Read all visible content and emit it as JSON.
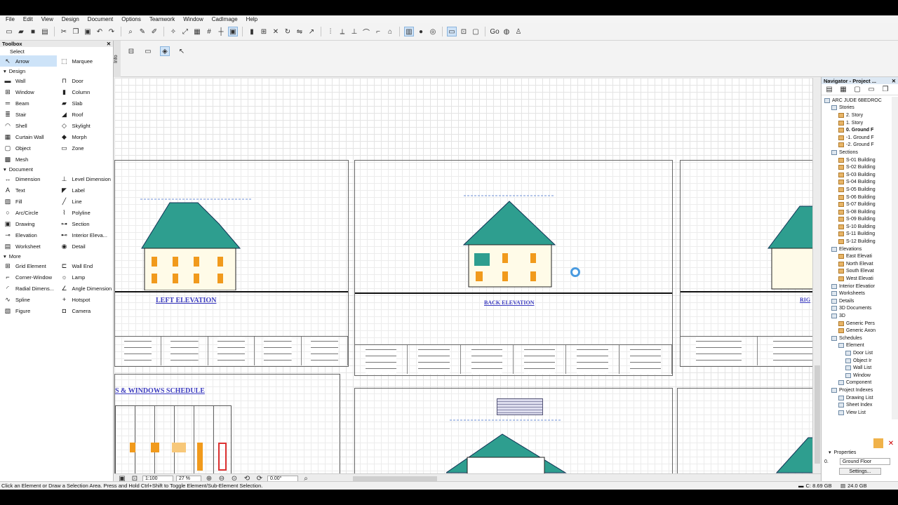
{
  "menu": [
    "File",
    "Edit",
    "View",
    "Design",
    "Document",
    "Options",
    "Teamwork",
    "Window",
    "CadImage",
    "Help"
  ],
  "toolbox": {
    "title": "Toolbox",
    "select_label": "Select",
    "select_items": [
      "Arrow",
      "Marquee"
    ],
    "sections": [
      {
        "name": "Design",
        "items": [
          [
            "Wall",
            "Door"
          ],
          [
            "Window",
            "Column"
          ],
          [
            "Beam",
            "Slab"
          ],
          [
            "Stair",
            "Roof"
          ],
          [
            "Shell",
            "Skylight"
          ],
          [
            "Curtain Wall",
            "Morph"
          ],
          [
            "Object",
            "Zone"
          ],
          [
            "Mesh",
            ""
          ]
        ]
      },
      {
        "name": "Document",
        "items": [
          [
            "Dimension",
            "Level Dimension"
          ],
          [
            "Text",
            "Label"
          ],
          [
            "Fill",
            "Line"
          ],
          [
            "Arc/Circle",
            "Polyline"
          ],
          [
            "Drawing",
            "Section"
          ],
          [
            "Elevation",
            "Interior Eleva..."
          ],
          [
            "Worksheet",
            "Detail"
          ]
        ]
      },
      {
        "name": "More",
        "items": [
          [
            "Grid Element",
            "Wall End"
          ],
          [
            "Corner-Window",
            "Lamp"
          ],
          [
            "Radial Dimens...",
            "Angle Dimension"
          ],
          [
            "Spline",
            "Hotspot"
          ],
          [
            "Figure",
            "Camera"
          ]
        ]
      }
    ]
  },
  "info_label": "Info",
  "canvas": {
    "left_elevation": "LEFT ELEVATION",
    "back_elevation": "BACK ELEVATION",
    "right_partial": "RIG",
    "schedule": "S & WINDOWS SCHEDULE"
  },
  "bottom": {
    "scale": "1:100",
    "zoom": "27 %",
    "angle": "0.00°"
  },
  "navigator": {
    "title": "Navigator - Project ...",
    "tree": [
      {
        "d": 0,
        "t": "ARC JUDE 6BEDROC",
        "k": "fo"
      },
      {
        "d": 1,
        "t": "Stories",
        "k": "fo"
      },
      {
        "d": 2,
        "t": "2. Story",
        "k": "fi"
      },
      {
        "d": 2,
        "t": "1. Story",
        "k": "fi"
      },
      {
        "d": 2,
        "t": "0. Ground F",
        "k": "fi",
        "b": true
      },
      {
        "d": 2,
        "t": "-1. Ground F",
        "k": "fi"
      },
      {
        "d": 2,
        "t": "-2. Ground F",
        "k": "fi"
      },
      {
        "d": 1,
        "t": "Sections",
        "k": "fo"
      },
      {
        "d": 2,
        "t": "S-01 Building",
        "k": "fi"
      },
      {
        "d": 2,
        "t": "S-02 Building",
        "k": "fi"
      },
      {
        "d": 2,
        "t": "S-03 Building",
        "k": "fi"
      },
      {
        "d": 2,
        "t": "S-04 Building",
        "k": "fi"
      },
      {
        "d": 2,
        "t": "S-05 Building",
        "k": "fi"
      },
      {
        "d": 2,
        "t": "S-06 Building",
        "k": "fi"
      },
      {
        "d": 2,
        "t": "S-07 Building",
        "k": "fi"
      },
      {
        "d": 2,
        "t": "S-08 Building",
        "k": "fi"
      },
      {
        "d": 2,
        "t": "S-09 Building",
        "k": "fi"
      },
      {
        "d": 2,
        "t": "S-10 Building",
        "k": "fi"
      },
      {
        "d": 2,
        "t": "S-11 Building",
        "k": "fi"
      },
      {
        "d": 2,
        "t": "S-12 Building",
        "k": "fi"
      },
      {
        "d": 1,
        "t": "Elevations",
        "k": "fo"
      },
      {
        "d": 2,
        "t": "East Elevati",
        "k": "fi"
      },
      {
        "d": 2,
        "t": "North Elevat",
        "k": "fi"
      },
      {
        "d": 2,
        "t": "South Elevat",
        "k": "fi"
      },
      {
        "d": 2,
        "t": "West Elevati",
        "k": "fi"
      },
      {
        "d": 1,
        "t": "Interior Elevatior",
        "k": "fo"
      },
      {
        "d": 1,
        "t": "Worksheets",
        "k": "fo"
      },
      {
        "d": 1,
        "t": "Details",
        "k": "fo"
      },
      {
        "d": 1,
        "t": "3D Documents",
        "k": "fo"
      },
      {
        "d": 1,
        "t": "3D",
        "k": "fo"
      },
      {
        "d": 2,
        "t": "Generic Pers",
        "k": "fi"
      },
      {
        "d": 2,
        "t": "Generic Axon",
        "k": "fi"
      },
      {
        "d": 1,
        "t": "Schedules",
        "k": "fo"
      },
      {
        "d": 2,
        "t": "Element",
        "k": "fo"
      },
      {
        "d": 3,
        "t": "Door List",
        "k": "fo"
      },
      {
        "d": 3,
        "t": "Object Ir",
        "k": "fo"
      },
      {
        "d": 3,
        "t": "Wall List",
        "k": "fo"
      },
      {
        "d": 3,
        "t": "Window",
        "k": "fo"
      },
      {
        "d": 2,
        "t": "Component",
        "k": "fo"
      },
      {
        "d": 1,
        "t": "Project Indexes",
        "k": "fo"
      },
      {
        "d": 2,
        "t": "Drawing List",
        "k": "fo"
      },
      {
        "d": 2,
        "t": "Sheet Index",
        "k": "fo"
      },
      {
        "d": 2,
        "t": "View List",
        "k": "fo"
      }
    ],
    "properties_label": "Properties",
    "prop_num": "0.",
    "prop_value": "Ground Floor",
    "settings": "Settings..."
  },
  "status": {
    "message": "Click an Element or Draw a Selection Area. Press and Hold Ctrl+Shift to Toggle Element/Sub-Element Selection.",
    "disk": "C: 8.69 GB",
    "ram": "24.0 GB"
  }
}
